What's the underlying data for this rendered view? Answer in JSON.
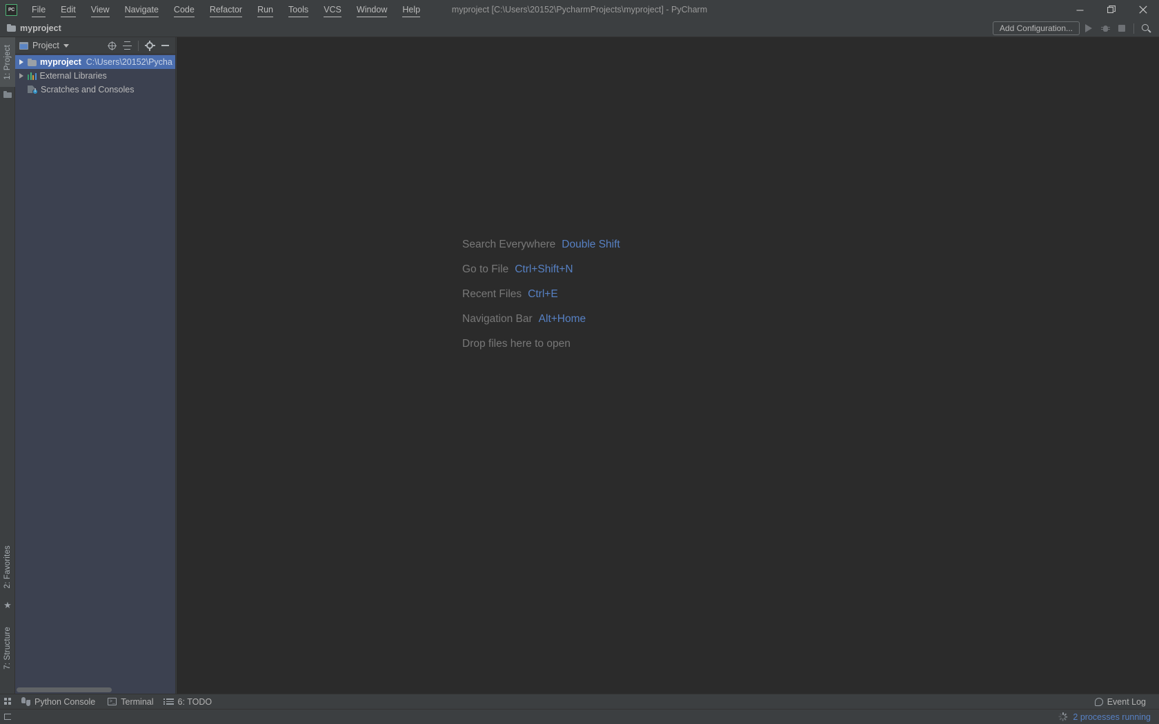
{
  "window": {
    "title": "myproject [C:\\Users\\20152\\PycharmProjects\\myproject] - PyCharm",
    "logo_text": "PC",
    "controls": {
      "minimize": "minimize-icon",
      "maximize": "maximize-icon",
      "close": "close-icon"
    },
    "colors": {
      "toolbar_bg": "#3c3f41",
      "editor_bg": "#2b2b2b",
      "project_bg": "#3c4150",
      "selection": "#4b6eaf",
      "accent_link": "#5781c4",
      "text": "#bbbbbb"
    }
  },
  "menubar": {
    "items": [
      {
        "label": "File",
        "mnemonic": "F"
      },
      {
        "label": "Edit",
        "mnemonic": "E"
      },
      {
        "label": "View",
        "mnemonic": "V"
      },
      {
        "label": "Navigate",
        "mnemonic": "N"
      },
      {
        "label": "Code",
        "mnemonic": "C"
      },
      {
        "label": "Refactor",
        "mnemonic": "R"
      },
      {
        "label": "Run",
        "mnemonic": "u"
      },
      {
        "label": "Tools",
        "mnemonic": "T"
      },
      {
        "label": "VCS",
        "mnemonic": "S"
      },
      {
        "label": "Window",
        "mnemonic": "W"
      },
      {
        "label": "Help",
        "mnemonic": "H"
      }
    ]
  },
  "navbar": {
    "breadcrumb": "myproject",
    "run_config_label": "Add Configuration...",
    "buttons": [
      {
        "name": "run-button",
        "icon": "play-icon"
      },
      {
        "name": "debug-button",
        "icon": "bug-icon"
      },
      {
        "name": "stop-button",
        "icon": "stop-icon"
      },
      {
        "name": "search-everywhere-button",
        "icon": "magnifier-icon"
      }
    ]
  },
  "left_stripe": {
    "tabs": [
      {
        "label": "1: Project",
        "number": "1",
        "name": "Project",
        "active": true
      },
      {
        "label": "2: Favorites",
        "number": "2",
        "name": "Favorites",
        "active": false
      },
      {
        "label": "7: Structure",
        "number": "7",
        "name": "Structure",
        "active": false
      }
    ]
  },
  "project_panel": {
    "title": "Project",
    "actions": [
      {
        "name": "locate-in-tree-icon",
        "tooltip": "Select Opened File"
      },
      {
        "name": "collapse-all-icon",
        "tooltip": "Collapse All"
      },
      {
        "name": "gear-icon",
        "tooltip": "Settings"
      },
      {
        "name": "hide-icon",
        "tooltip": "Hide"
      }
    ],
    "tree": [
      {
        "label": "myproject",
        "path": "C:\\Users\\20152\\Pycha",
        "icon": "folder-icon",
        "expandable": true,
        "expanded": false,
        "selected": true,
        "indent": 0
      },
      {
        "label": "External Libraries",
        "path": "",
        "icon": "libraries-icon",
        "expandable": true,
        "expanded": false,
        "selected": false,
        "indent": 0
      },
      {
        "label": "Scratches and Consoles",
        "path": "",
        "icon": "scratches-icon",
        "expandable": false,
        "expanded": false,
        "selected": false,
        "indent": 0
      }
    ]
  },
  "editor": {
    "hints": [
      {
        "label": "Search Everywhere",
        "shortcut": "Double Shift"
      },
      {
        "label": "Go to File",
        "shortcut": "Ctrl+Shift+N"
      },
      {
        "label": "Recent Files",
        "shortcut": "Ctrl+E"
      },
      {
        "label": "Navigation Bar",
        "shortcut": "Alt+Home"
      },
      {
        "label": "Drop files here to open",
        "shortcut": ""
      }
    ]
  },
  "bottom_bar": {
    "items": [
      {
        "label": "Python Console",
        "icon": "python-icon",
        "mnemonic": ""
      },
      {
        "label": "Terminal",
        "icon": "terminal-icon",
        "mnemonic": ""
      },
      {
        "label": "6: TODO",
        "icon": "todo-icon",
        "mnemonic": "6"
      }
    ],
    "event_log": "Event Log"
  },
  "status_bar": {
    "processes": "2 processes running"
  }
}
